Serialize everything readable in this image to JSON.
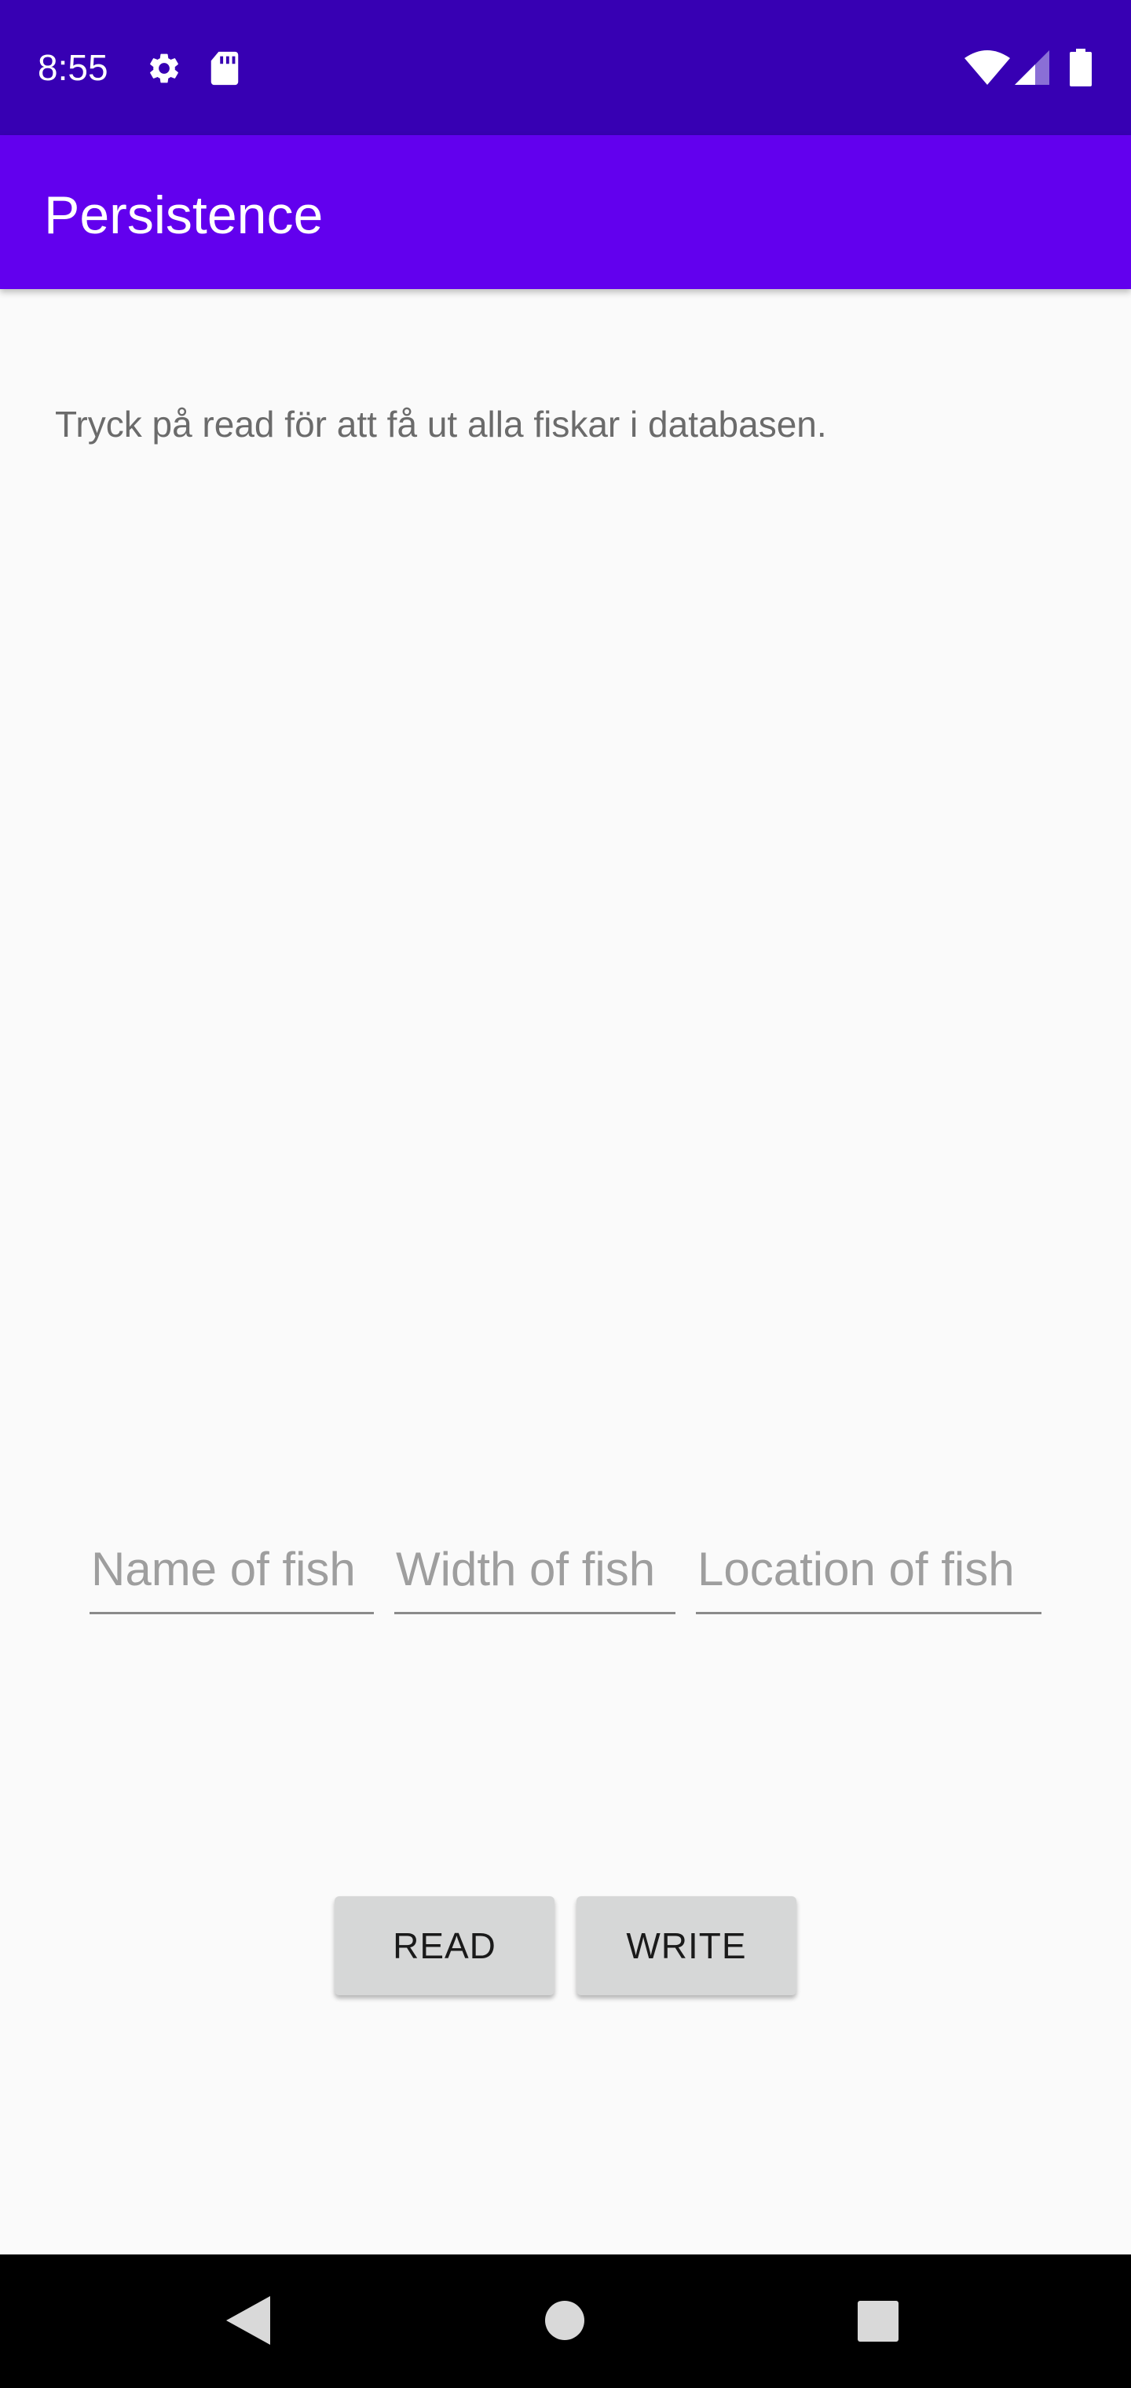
{
  "status_bar": {
    "time": "8:55",
    "icons": [
      "gear-icon",
      "sd-card-icon",
      "wifi-icon",
      "cellular-signal-icon",
      "battery-icon"
    ],
    "background": "#3700b3"
  },
  "app_bar": {
    "title": "Persistence",
    "background": "#6200ee"
  },
  "main": {
    "info_text": "Tryck på read för att få ut alla fiskar i databasen.",
    "inputs": {
      "name": {
        "placeholder": "Name of fish",
        "value": ""
      },
      "width": {
        "placeholder": "Width of fish",
        "value": ""
      },
      "location": {
        "placeholder": "Location of fish",
        "value": ""
      }
    },
    "buttons": {
      "read_label": "READ",
      "write_label": "WRITE"
    }
  },
  "nav_bar": {
    "icons": [
      "back-icon",
      "home-icon",
      "recents-icon"
    ],
    "background": "#000000"
  }
}
